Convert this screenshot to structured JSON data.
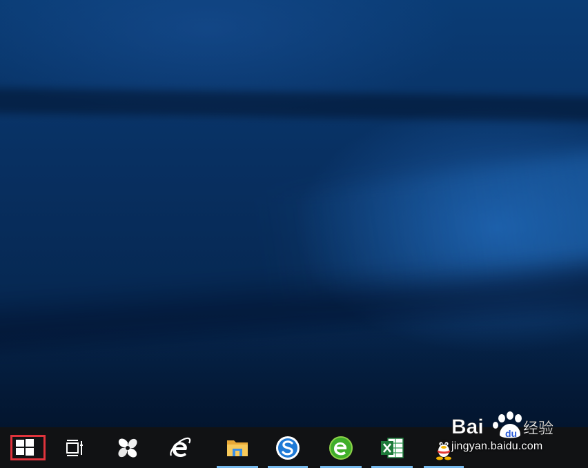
{
  "desktop": {
    "wallpaper_colors": [
      "#0a3c75",
      "#062852",
      "#2878d2"
    ]
  },
  "taskbar": {
    "background": "#111214",
    "start_highlight_color": "#e0343c",
    "items": [
      {
        "name": "start-button",
        "icon": "windows-logo-icon"
      },
      {
        "name": "task-view-button",
        "icon": "task-view-icon"
      },
      {
        "name": "pinwheel-app",
        "icon": "pinwheel-icon"
      },
      {
        "name": "internet-explorer",
        "icon": "ie-icon"
      },
      {
        "name": "file-explorer",
        "icon": "folder-icon"
      },
      {
        "name": "sogou-browser",
        "icon": "sogou-s-icon"
      },
      {
        "name": "360-browser",
        "icon": "green-e-icon"
      },
      {
        "name": "excel",
        "icon": "excel-icon"
      },
      {
        "name": "qq",
        "icon": "qq-penguin-icon"
      }
    ]
  },
  "watermark": {
    "brand_left": "Bai",
    "brand_right": "经验",
    "url": "jingyan.baidu.com"
  }
}
